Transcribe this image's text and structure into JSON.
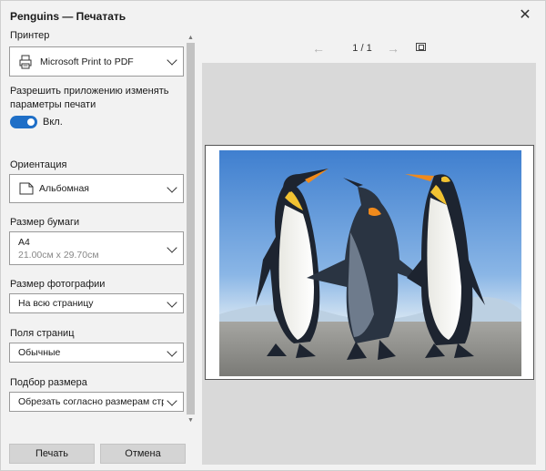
{
  "window": {
    "title": "Penguins — Печатать"
  },
  "printer": {
    "label": "Принтер",
    "value": "Microsoft Print to PDF"
  },
  "app_changes": {
    "label": "Разрешить приложению изменять параметры печати",
    "toggle_text": "Вкл.",
    "toggle_on": true
  },
  "orientation": {
    "label": "Ориентация",
    "value": "Альбомная"
  },
  "paper_size": {
    "label": "Размер бумаги",
    "value": "A4",
    "dims": "21.00см x 29.70см"
  },
  "photo_size": {
    "label": "Размер фотографии",
    "value": "На всю страницу"
  },
  "margins": {
    "label": "Поля страниц",
    "value": "Обычные"
  },
  "fit": {
    "label": "Подбор размера",
    "value": "Обрезать согласно размерам стран"
  },
  "buttons": {
    "print": "Печать",
    "cancel": "Отмена"
  },
  "preview": {
    "pages": "1 / 1"
  },
  "colors": {
    "accent": "#1f6fc7"
  },
  "icons": {
    "close": "close-icon",
    "printer": "printer-icon",
    "orientation": "landscape-page-icon",
    "prev": "arrow-left-icon",
    "next": "arrow-right-icon",
    "fit": "fit-page-icon"
  }
}
